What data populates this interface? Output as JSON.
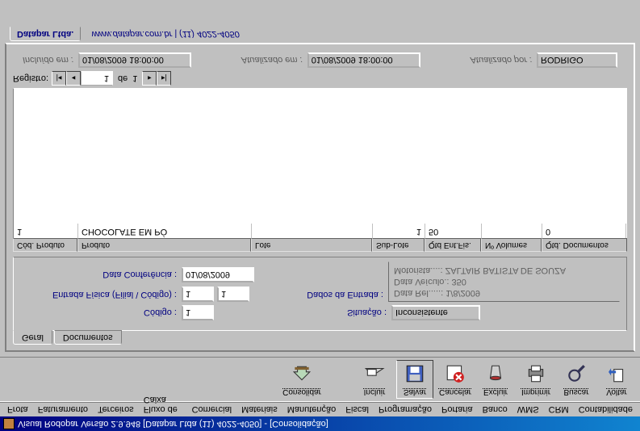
{
  "title_bar": "Visual Rodopar Versão 2.9.948 [Datapar Ltda (11) 4022-4050]  -  [Consolidação]",
  "menu": [
    "Frota",
    "Faturamento",
    "Terceiros",
    "Fluxo de Caixa",
    "Comercial",
    "Materiais",
    "Manutenção",
    "Fiscal",
    "Programação",
    "Portaria",
    "Banco",
    "WMS",
    "CRM",
    "Contabilidade"
  ],
  "toolbar": {
    "consolidar": "Consolidar",
    "incluir": "Incluir",
    "salvar": "Salvar",
    "cancelar": "Cancelar",
    "excluir": "Excluir",
    "imprimir": "Imprimir",
    "buscar": "Buscar",
    "voltar": "Voltar"
  },
  "tabs": {
    "geral": "Geral",
    "documentos": "Documentos"
  },
  "form": {
    "codigo_label": "Código :",
    "codigo_value": "1",
    "situacao_label": "Situação :",
    "situacao_value": "Inconsistente",
    "entrada_fisica_label": "Entrada Física (Filial \\ Código) :",
    "entrada_fisica_filial": "1",
    "entrada_fisica_codigo": "1",
    "dados_entrada_label": "Dados da Entrada :",
    "data_conferencia_label": "Data Conferência :",
    "data_conferencia_value": "01/08/2009"
  },
  "entrada_info": {
    "line1": "Data Rel.....: 1/8/2009",
    "line2": "Data Veículo.: 350",
    "line3": "Motorista....: ZALTAIR BATISTA DE SOUZA"
  },
  "grid": {
    "headers": [
      "Cód. Produto",
      "Produto",
      "Lote",
      "Sub-Lote",
      "Qtd Ent.Fis.",
      "Nº Volumes",
      "Qtd. Documentos"
    ],
    "row": {
      "cod_produto": "1",
      "produto": "CHOCOLATE EM PÓ",
      "lote": "",
      "sub_lote": "1",
      "qtd_ent_fis": "50",
      "n_volumes": "",
      "qtd_documentos": "0"
    }
  },
  "record_nav": {
    "label": "Registro:",
    "pos": "1",
    "total_prefix": "de",
    "total": "1"
  },
  "audit": {
    "incluido_em_label": "Incluído em :",
    "incluido_em_value": "01/08/2009 18:00:00",
    "atualizado_em_label": "Atualizado em :",
    "atualizado_em_value": "01/08/2009 18:00:00",
    "atualizado_por_label": "Atualizado por :",
    "atualizado_por_value": "RODRIGO"
  },
  "company": {
    "tab": "Datapar Ltda.",
    "rest": "www.datapar.com.br  |  (11) 4022-4050"
  }
}
